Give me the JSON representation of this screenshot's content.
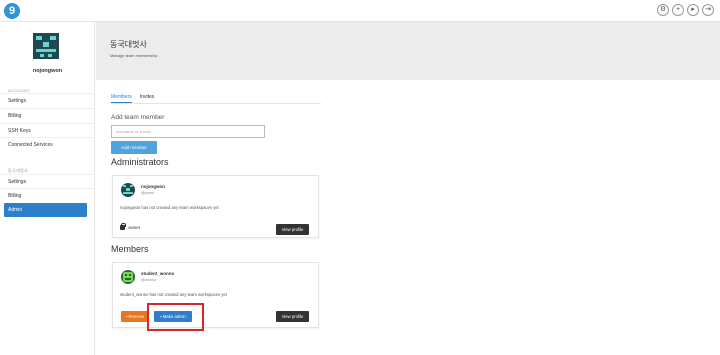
{
  "app": {
    "logo_glyph": "9"
  },
  "topbar": {
    "icons": [
      "settings-icon",
      "plus-icon",
      "play-icon",
      "logout-icon"
    ],
    "glyphs": [
      "⚙",
      "+",
      "▸",
      "⇥"
    ]
  },
  "sidebar": {
    "username": "nojongwon",
    "account_section": "ACCOUNT",
    "account_items": [
      "Settings",
      "Billing",
      "SSH Keys",
      "Connected Services"
    ],
    "team_section": "동국대멋사",
    "team_items": [
      "Settings",
      "Billing",
      "Admin"
    ],
    "active_item": "Admin"
  },
  "header": {
    "title": "동국대멋사",
    "subtitle": "Manage team membership"
  },
  "tabs": [
    "Members",
    "Invites"
  ],
  "active_tab": "Members",
  "add_member": {
    "label": "Add team member",
    "placeholder": "username or e-mail",
    "button": "Add member"
  },
  "administrators": {
    "heading": "Administrators",
    "items": [
      {
        "name": "nojongwon",
        "handle": "@jonno",
        "note": "nojongwon has not created any team workspaces yet",
        "role": "owner",
        "view_label": "View profile"
      }
    ]
  },
  "members": {
    "heading": "Members",
    "items": [
      {
        "name": "student_wonno",
        "handle": "@wonno",
        "note": "student_wonno has not created any team workspaces yet",
        "remove_label": "Remove",
        "make_admin_label": "Make admin",
        "view_label": "View profile"
      }
    ]
  },
  "colors": {
    "accent": "#2d80c8",
    "remove": "#e8741e",
    "highlight": "#d6262a"
  }
}
